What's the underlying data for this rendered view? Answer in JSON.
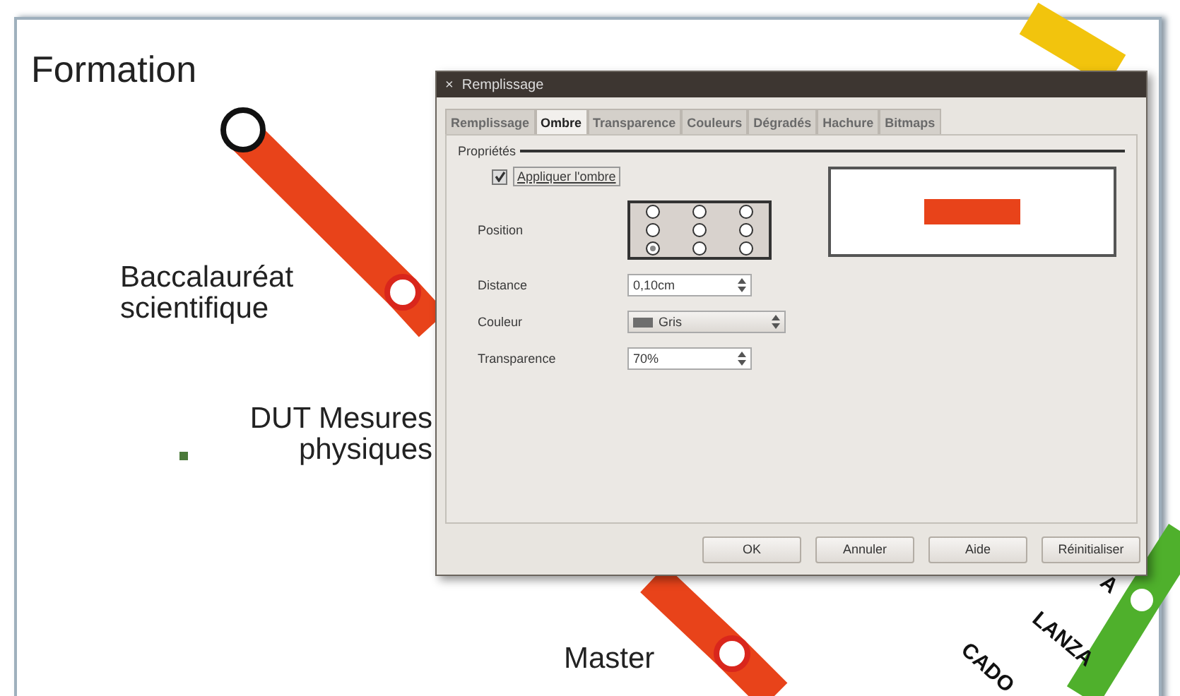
{
  "slide": {
    "stations": [
      {
        "label": "Formation"
      },
      {
        "label": "Baccalauréat scientifique"
      },
      {
        "label": "DUT Mesures physiques"
      },
      {
        "label": "Master"
      }
    ],
    "street_labels": [
      {
        "label": "A"
      },
      {
        "label": "LANZA"
      },
      {
        "label": "CADO"
      }
    ]
  },
  "dialog": {
    "title": "Remplissage",
    "close": "×",
    "tabs": [
      {
        "label": "Remplissage",
        "selected": false
      },
      {
        "label": "Ombre",
        "selected": true
      },
      {
        "label": "Transparence",
        "selected": false
      },
      {
        "label": "Couleurs",
        "selected": false
      },
      {
        "label": "Dégradés",
        "selected": false
      },
      {
        "label": "Hachure",
        "selected": false
      },
      {
        "label": "Bitmaps",
        "selected": false
      }
    ],
    "section": "Propriétés",
    "apply_shadow": {
      "label": "Appliquer l'ombre",
      "checked": true
    },
    "position": {
      "label": "Position",
      "points": [
        {
          "selected": false
        },
        {
          "selected": false
        },
        {
          "selected": false
        },
        {
          "selected": false
        },
        {
          "selected": false
        },
        {
          "selected": false
        },
        {
          "selected": true
        },
        {
          "selected": false
        },
        {
          "selected": false
        }
      ]
    },
    "fields": [
      {
        "kind": "spin",
        "label": "Distance",
        "value": "0,10cm"
      },
      {
        "kind": "dropdown",
        "label": "Couleur",
        "value": "Gris",
        "color": "#6e6e6e"
      },
      {
        "kind": "spin",
        "label": "Transparence",
        "value": "70%"
      }
    ],
    "buttons": [
      "OK",
      "Annuler",
      "Aide",
      "Réinitialiser"
    ]
  }
}
